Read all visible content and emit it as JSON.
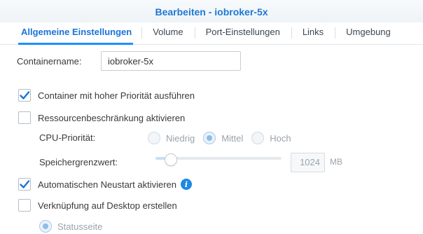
{
  "window": {
    "title": "Bearbeiten - iobroker-5x"
  },
  "tabs": [
    {
      "label": "Allgemeine Einstellungen",
      "active": true
    },
    {
      "label": "Volume"
    },
    {
      "label": "Port-Einstellungen"
    },
    {
      "label": "Links"
    },
    {
      "label": "Umgebung"
    }
  ],
  "general": {
    "container_name_label": "Containername:",
    "container_name_value": "iobroker-5x",
    "high_priority": {
      "label": "Container mit hoher Priorität ausführen",
      "checked": true
    },
    "resource_limit": {
      "label": "Ressourcenbeschränkung aktivieren",
      "checked": false
    },
    "cpu_priority": {
      "label": "CPU-Priorität:",
      "options": [
        {
          "label": "Niedrig",
          "selected": false
        },
        {
          "label": "Mittel",
          "selected": true
        },
        {
          "label": "Hoch",
          "selected": false
        }
      ]
    },
    "memory_limit": {
      "label": "Speichergrenzwert:",
      "value": "1024",
      "unit": "MB",
      "slider_fraction": 0.08
    },
    "auto_restart": {
      "label": "Automatischen Neustart aktivieren",
      "checked": true
    },
    "desktop_shortcut": {
      "label": "Verknüpfung auf Desktop erstellen",
      "checked": false
    },
    "shortcut_option": {
      "label": "Statusseite",
      "selected": true
    }
  },
  "colors": {
    "accent": "#1e78d4",
    "check": "#1a73d8"
  }
}
